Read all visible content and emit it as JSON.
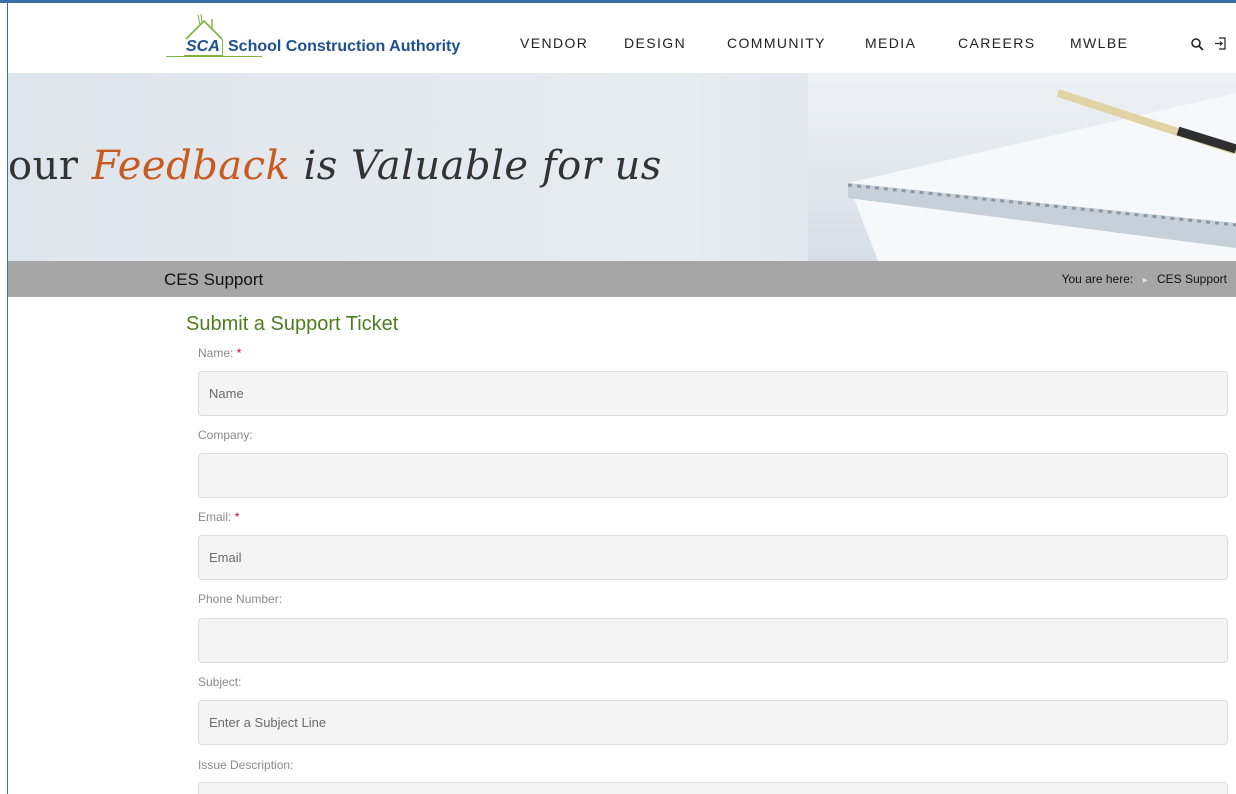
{
  "header": {
    "logo_mark": "SCA",
    "logo_name": "School Construction Authority",
    "nav": [
      "VENDOR",
      "DESIGN",
      "COMMUNITY",
      "MEDIA",
      "CAREERS",
      "MWLBE"
    ],
    "icons": [
      "search-icon",
      "login-icon"
    ]
  },
  "banner": {
    "word1": "our",
    "word2": "Feedback",
    "word3": "is Valuable",
    "word4": "for",
    "word5": "us"
  },
  "titlebar": {
    "title": "CES Support",
    "breadcrumb_prefix": "You are here:",
    "breadcrumb_current": "CES Support"
  },
  "form": {
    "title": "Submit a Support Ticket",
    "required_marker": "*",
    "name_label": "Name:",
    "name_placeholder": "Name",
    "company_label": "Company:",
    "company_placeholder": "",
    "email_label": "Email:",
    "email_placeholder": "Email",
    "phone_label": "Phone Number:",
    "phone_placeholder": "",
    "subject_label": "Subject:",
    "subject_placeholder": "Enter a Subject Line",
    "issue_label": "Issue Description:"
  },
  "colors": {
    "brand_blue": "#1d4f91",
    "brand_green": "#7fb241",
    "form_title_green": "#4e7d1e",
    "banner_accent": "#c85a1e",
    "titlebar_gray": "#a6a6a6",
    "required_red": "#d0021b"
  }
}
